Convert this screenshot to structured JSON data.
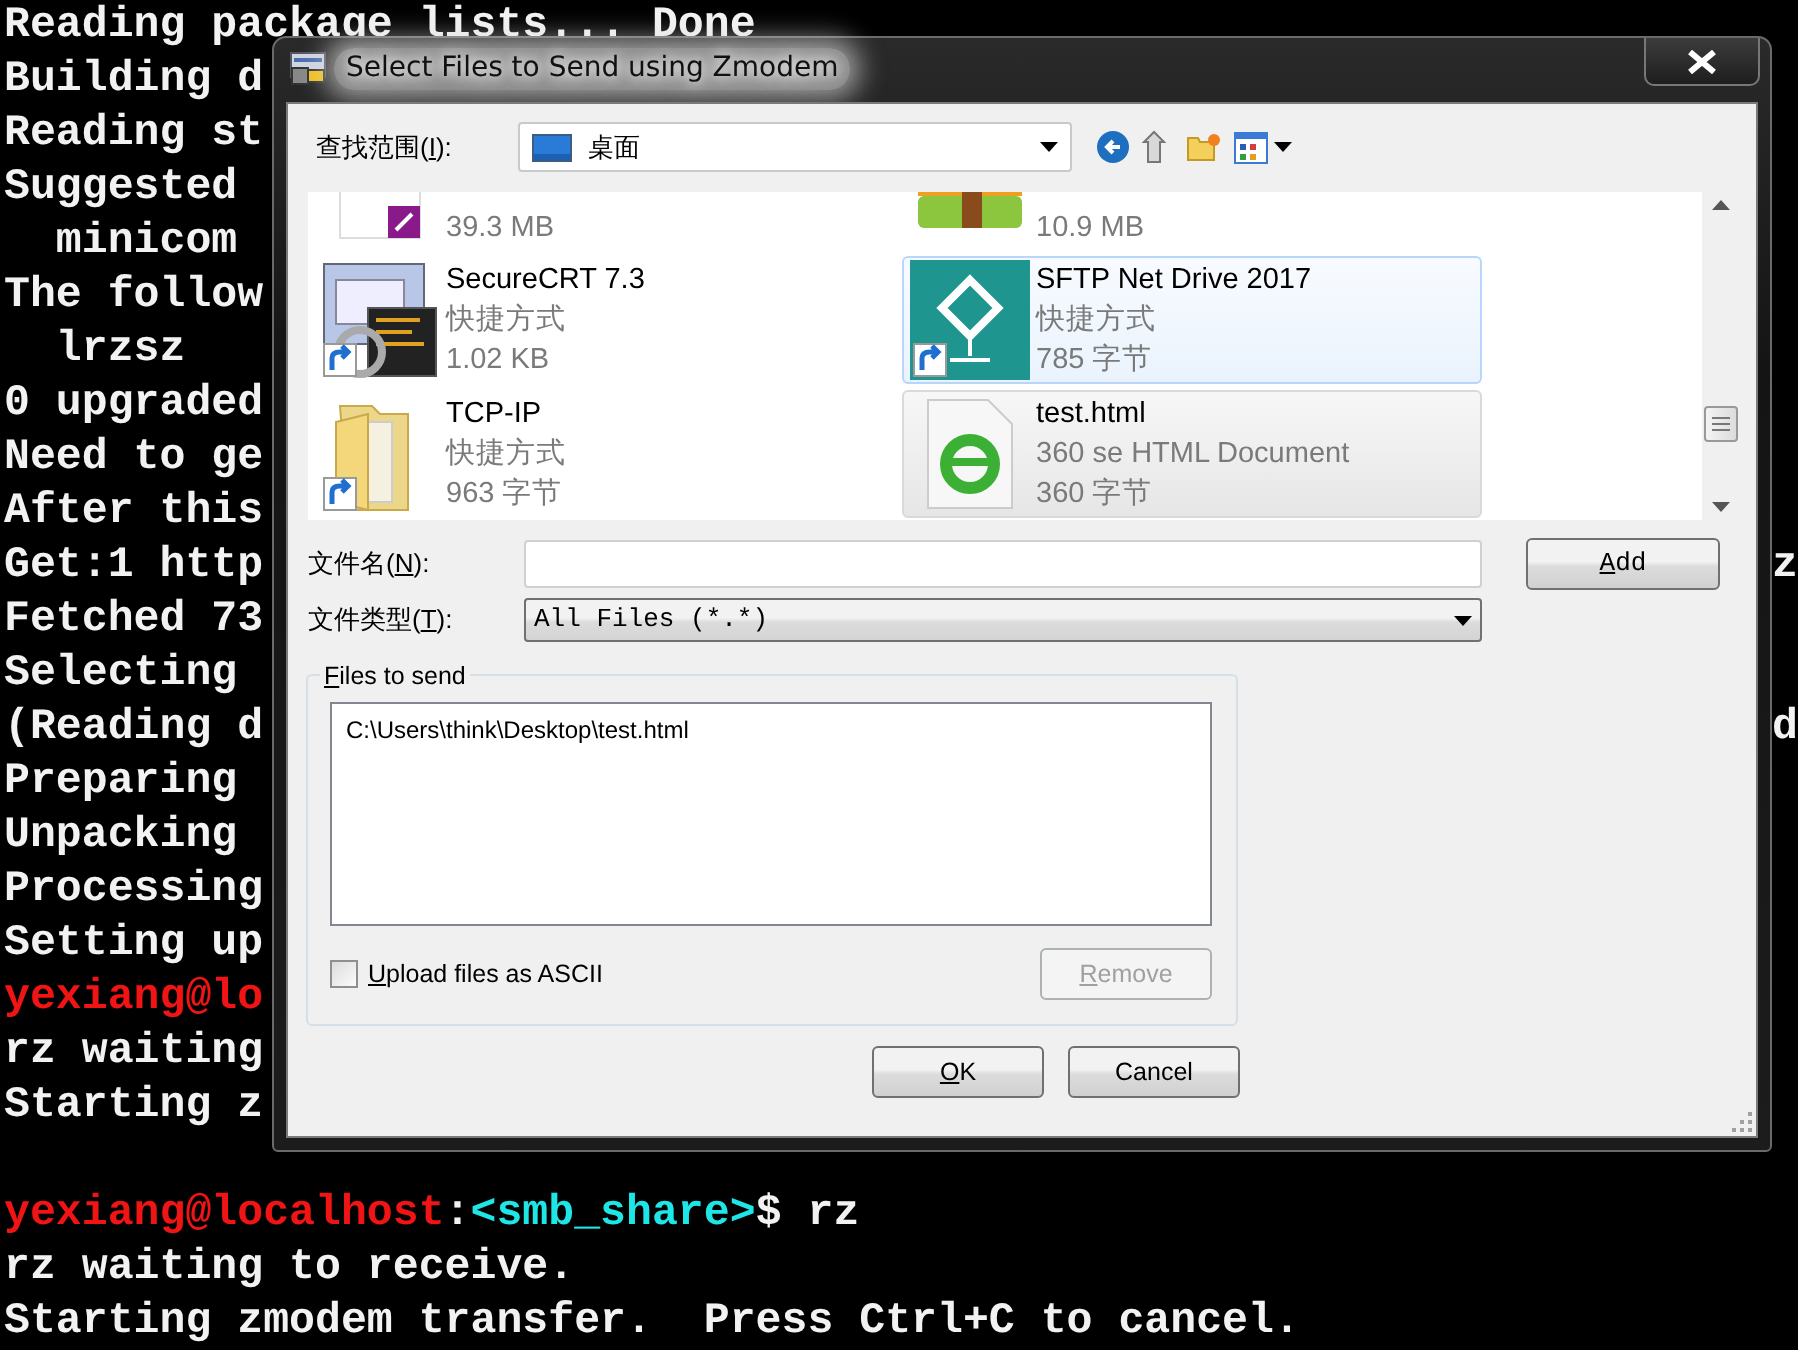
{
  "terminal": {
    "lines": [
      {
        "segments": [
          {
            "text": "Reading package lists... Done",
            "color": "#f2f2f2"
          }
        ]
      },
      {
        "segments": [
          {
            "text": "Building d",
            "color": "#f2f2f2"
          }
        ]
      },
      {
        "segments": [
          {
            "text": "Reading st",
            "color": "#f2f2f2"
          }
        ]
      },
      {
        "segments": [
          {
            "text": "Suggested",
            "color": "#f2f2f2"
          }
        ]
      },
      {
        "segments": [
          {
            "text": "  minicom",
            "color": "#f2f2f2"
          }
        ]
      },
      {
        "segments": [
          {
            "text": "The follow",
            "color": "#f2f2f2"
          }
        ]
      },
      {
        "segments": [
          {
            "text": "  lrzsz",
            "color": "#f2f2f2"
          }
        ]
      },
      {
        "segments": [
          {
            "text": "0 upgraded",
            "color": "#f2f2f2"
          }
        ]
      },
      {
        "segments": [
          {
            "text": "Need to ge",
            "color": "#f2f2f2"
          }
        ]
      },
      {
        "segments": [
          {
            "text": "After this",
            "color": "#f2f2f2"
          }
        ]
      },
      {
        "segments": [
          {
            "text": "Get:1 http",
            "color": "#f2f2f2"
          }
        ],
        "tail": "z"
      },
      {
        "segments": [
          {
            "text": "Fetched 73",
            "color": "#f2f2f2"
          }
        ]
      },
      {
        "segments": [
          {
            "text": "Selecting",
            "color": "#f2f2f2"
          }
        ]
      },
      {
        "segments": [
          {
            "text": "(Reading d",
            "color": "#f2f2f2"
          }
        ],
        "tail": "d"
      },
      {
        "segments": [
          {
            "text": "Preparing",
            "color": "#f2f2f2"
          }
        ]
      },
      {
        "segments": [
          {
            "text": "Unpacking",
            "color": "#f2f2f2"
          }
        ]
      },
      {
        "segments": [
          {
            "text": "Processing",
            "color": "#f2f2f2"
          }
        ]
      },
      {
        "segments": [
          {
            "text": "Setting up",
            "color": "#f2f2f2"
          }
        ]
      },
      {
        "segments": [
          {
            "text": "yexiang@lo",
            "color": "#f01414"
          }
        ]
      },
      {
        "segments": [
          {
            "text": "rz waiting",
            "color": "#f2f2f2"
          }
        ]
      },
      {
        "segments": [
          {
            "text": "Starting z",
            "color": "#f2f2f2"
          }
        ]
      }
    ],
    "latest_lines": [
      {
        "segments": [
          {
            "text": "yexiang@localhost",
            "color": "#f01414"
          },
          {
            "text": ":",
            "color": "#f2f2f2"
          },
          {
            "text": "<smb_share>",
            "color": "#1ee6e6"
          },
          {
            "text": "$ rz",
            "color": "#f2f2f2"
          }
        ]
      },
      {
        "segments": [
          {
            "text": "rz waiting to receive.",
            "color": "#f2f2f2"
          }
        ]
      },
      {
        "segments": [
          {
            "text": "Starting zmodem transfer.  Press Ctrl+C to cancel.",
            "color": "#f2f2f2"
          }
        ]
      }
    ]
  },
  "dialog": {
    "title": "Select Files to Send using Zmodem",
    "look_in": {
      "label": {
        "pre": "查找范围(",
        "key": "I",
        "post": "):"
      },
      "value": "桌面"
    },
    "files": [
      {
        "kind": "pdf",
        "size": "39.3 MB",
        "shortcut": false,
        "hovered": false,
        "selected": false
      },
      {
        "kind": "zip",
        "size": "10.9 MB",
        "shortcut": false,
        "hovered": false,
        "selected": false
      },
      {
        "kind": "app",
        "name": "SecureCRT 7.3",
        "type": "快捷方式",
        "size": "1.02 KB",
        "shortcut": true,
        "hovered": false,
        "selected": false
      },
      {
        "kind": "network",
        "name": "SFTP Net Drive 2017",
        "type": "快捷方式",
        "size": "785 字节",
        "shortcut": true,
        "hovered": true,
        "selected": false
      },
      {
        "kind": "folder",
        "name": "TCP-IP",
        "type": "快捷方式",
        "size": "963 字节",
        "shortcut": true,
        "hovered": false,
        "selected": false
      },
      {
        "kind": "html",
        "name": "test.html",
        "type": "360 se HTML Document",
        "size": "360 字节",
        "shortcut": false,
        "hovered": false,
        "selected": true
      }
    ],
    "file_name": {
      "label": {
        "pre": "文件名(",
        "key": "N",
        "post": "):"
      }
    },
    "add_button": {
      "label": {
        "key": "A",
        "post": "dd"
      }
    },
    "file_type": {
      "label": {
        "pre": "文件类型(",
        "key": "T",
        "post": "):"
      },
      "value": "All Files (*.*)"
    },
    "files_to_send": {
      "legend": {
        "key": "F",
        "post": "iles to send"
      },
      "items": [
        "C:\\Users\\think\\Desktop\\test.html"
      ],
      "ascii": {
        "label": {
          "key": "U",
          "post": "pload files as ASCII"
        },
        "checked": false
      },
      "remove_button": {
        "label": {
          "key": "R",
          "post": "emove"
        },
        "disabled": true
      }
    },
    "ok_button": {
      "label": {
        "key": "O",
        "post": "K"
      }
    },
    "cancel_button": {
      "label": {
        "post": "Cancel"
      }
    }
  }
}
